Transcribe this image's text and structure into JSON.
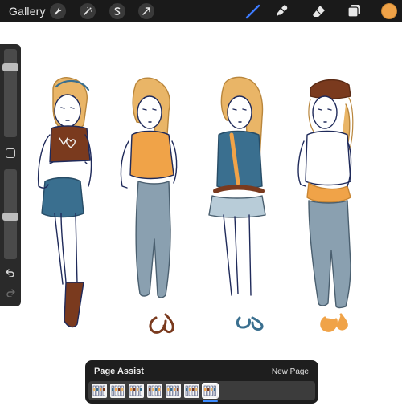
{
  "toolbar": {
    "gallery_label": "Gallery",
    "left_tools": [
      {
        "name": "wrench-icon"
      },
      {
        "name": "magic-wand-icon"
      },
      {
        "name": "selection-icon"
      },
      {
        "name": "transform-arrow-icon"
      }
    ],
    "right_tools": [
      {
        "name": "brush-icon",
        "active": true
      },
      {
        "name": "smudge-icon",
        "active": false
      },
      {
        "name": "eraser-icon",
        "active": false
      },
      {
        "name": "layers-icon",
        "active": false
      }
    ],
    "current_color": "#f0a348",
    "active_tool_color": "#3d7bff"
  },
  "sidebar": {
    "brush_size_level": 0.82,
    "opacity_level": 0.46
  },
  "page_assist": {
    "title": "Page Assist",
    "new_page_label": "New Page",
    "page_count": 7,
    "active_page": 7
  },
  "colors": {
    "hair": "#e9b567",
    "jacket_orange": "#f0a348",
    "denim": "#3a6f8f",
    "jeans": "#8aa0b0",
    "brown": "#7a3a1e",
    "outline": "#1f2a5a"
  }
}
